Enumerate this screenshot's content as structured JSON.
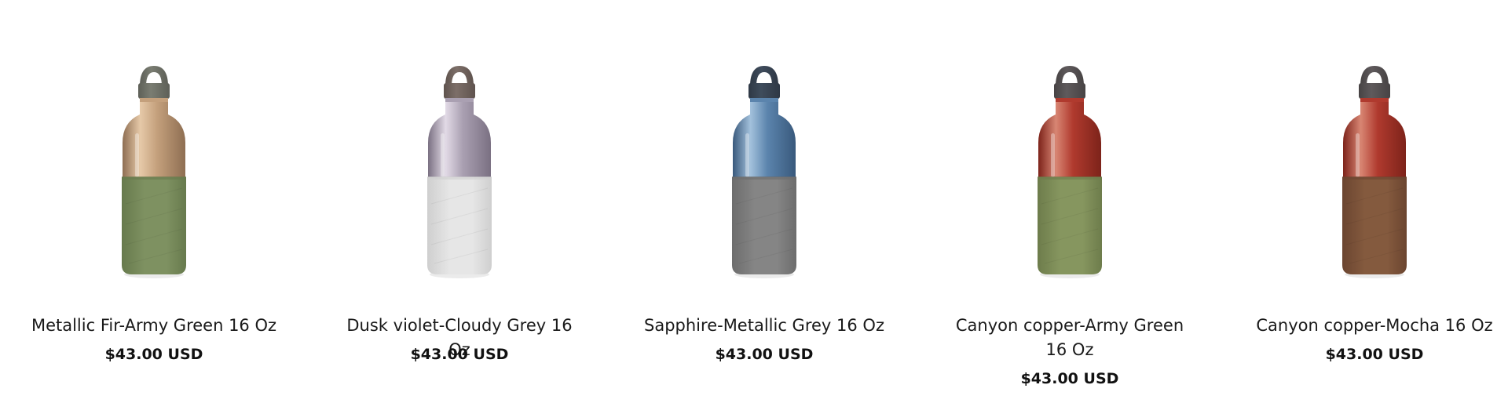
{
  "products": [
    {
      "title": "Metallic Fir-Army Green 16 Oz",
      "price": "$43.00 USD",
      "colors": {
        "cap": "#7a7d72",
        "cap_dark": "#5d5f57",
        "metal_light": "#e6c9a8",
        "metal_mid": "#c4a07c",
        "metal_dark": "#8e6e52",
        "sleeve": "#7e9161",
        "sleeve_dark": "#677a4d"
      }
    },
    {
      "title": "Dusk violet-Cloudy Grey 16 Oz",
      "price": "$43.00 USD",
      "colors": {
        "cap": "#7d6f69",
        "cap_dark": "#5f534e",
        "metal_light": "#e2dae6",
        "metal_mid": "#aaa0b2",
        "metal_dark": "#7a7082",
        "sleeve": "#e6e6e6",
        "sleeve_dark": "#cfcfcf"
      }
    },
    {
      "title": "Sapphire-Metallic Grey 16 Oz",
      "price": "$43.00 USD",
      "colors": {
        "cap": "#3f4c5c",
        "cap_dark": "#2e3845",
        "metal_light": "#a3c1dc",
        "metal_mid": "#5b84ad",
        "metal_dark": "#39597c",
        "sleeve": "#858585",
        "sleeve_dark": "#6d6d6d"
      }
    },
    {
      "title": "Canyon copper-Army Green 16 Oz",
      "price": "$43.00 USD",
      "colors": {
        "cap": "#5f5a5c",
        "cap_dark": "#474344",
        "metal_light": "#d88673",
        "metal_mid": "#b03a2e",
        "metal_dark": "#7d231a",
        "sleeve": "#86965f",
        "sleeve_dark": "#6d7c4b"
      }
    },
    {
      "title": "Canyon copper-Mocha 16 Oz",
      "price": "$43.00 USD",
      "colors": {
        "cap": "#5f5a5c",
        "cap_dark": "#474344",
        "metal_light": "#d88673",
        "metal_mid": "#b03a2e",
        "metal_dark": "#7d231a",
        "sleeve": "#845a3e",
        "sleeve_dark": "#6b4530"
      }
    }
  ]
}
